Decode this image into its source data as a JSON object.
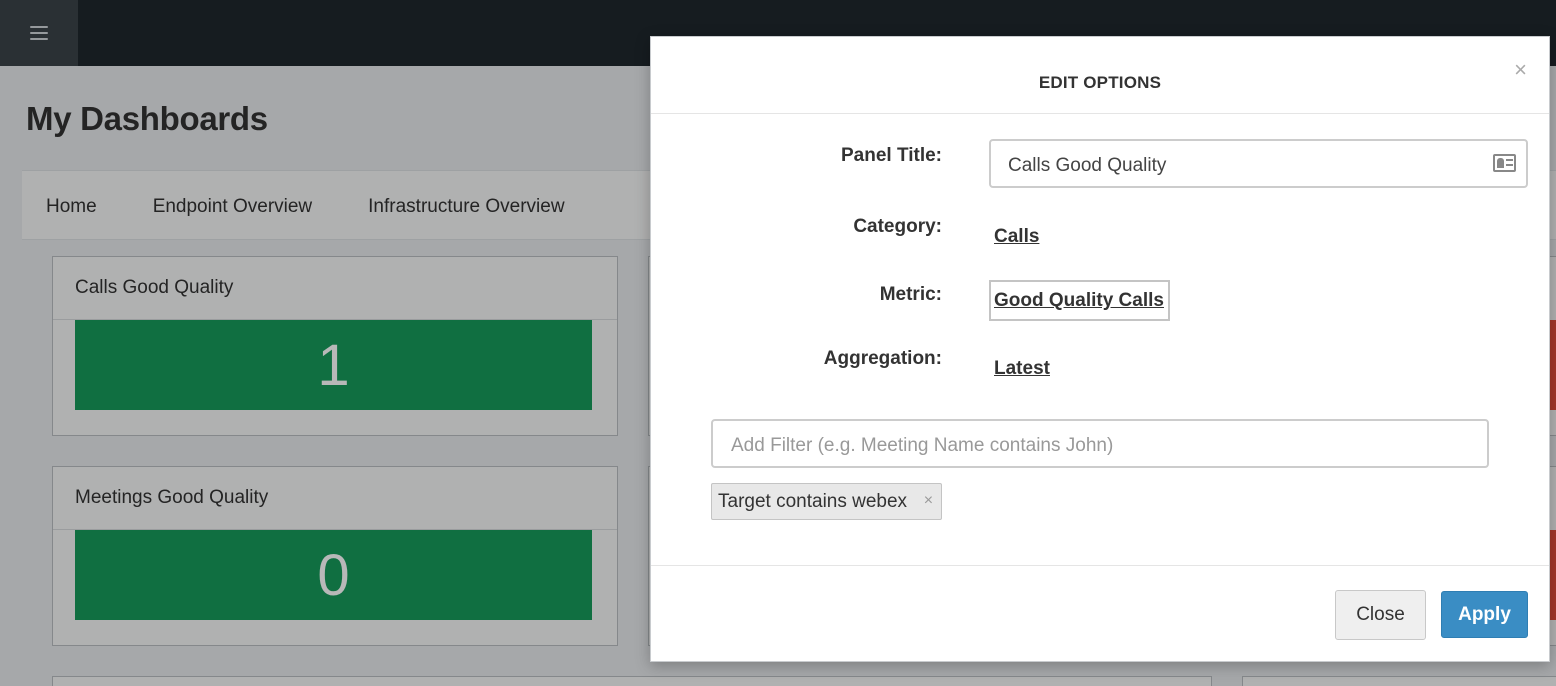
{
  "app": {
    "page_title": "My Dashboards"
  },
  "tabs": [
    {
      "label": "Home"
    },
    {
      "label": "Endpoint Overview"
    },
    {
      "label": "Infrastructure Overview"
    }
  ],
  "panels": [
    {
      "title": "Calls Good Quality",
      "value": "1",
      "color": "#179a5b"
    },
    {
      "title": "Meetings Good Quality",
      "value": "0",
      "color": "#179a5b"
    }
  ],
  "modal": {
    "title": "EDIT OPTIONS",
    "close_glyph": "×",
    "fields": {
      "panel_title_label": "Panel Title:",
      "panel_title_value": "Calls Good Quality",
      "category_label": "Category:",
      "category_value": "Calls",
      "metric_label": "Metric:",
      "metric_value": "Good Quality Calls",
      "aggregation_label": "Aggregation:",
      "aggregation_value": "Latest"
    },
    "filter": {
      "placeholder": "Add Filter (e.g. Meeting Name contains John)",
      "chips": [
        {
          "label": "Target contains webex",
          "remove_glyph": "×"
        }
      ]
    },
    "footer": {
      "close_label": "Close",
      "apply_label": "Apply"
    }
  },
  "colors": {
    "topbar": "#1f272d",
    "good": "#179a5b",
    "bad": "#e24b3b",
    "primary": "#3a8dc4"
  },
  "icons": {
    "menu": "hamburger-menu-icon",
    "input_card": "contact-card-icon"
  }
}
